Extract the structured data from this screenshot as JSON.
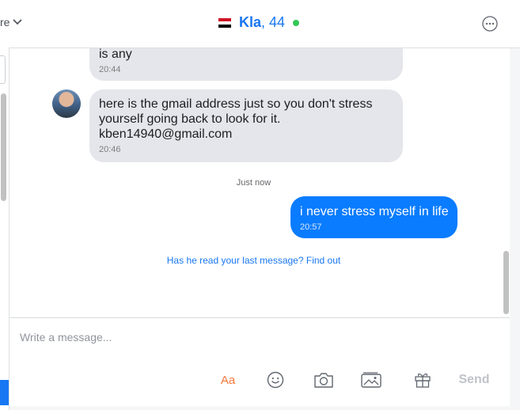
{
  "header": {
    "more_label": "re",
    "contact_name": "Kla",
    "contact_age": ", 44",
    "online": true,
    "colors": {
      "accent": "#1877f2",
      "online": "#31c754"
    }
  },
  "messages": [
    {
      "direction": "in",
      "text": "is any",
      "time": "20:44"
    },
    {
      "direction": "in",
      "text": "here is the gmail address just so you don't stress\nyourself going back to look for it.\nkben14940@gmail.com",
      "time": "20:46"
    },
    {
      "divider": "Just now"
    },
    {
      "direction": "out",
      "text": "i never stress myself in life",
      "time": "20:57"
    }
  ],
  "read_prompt": "Has he read your last message? Find out",
  "composer": {
    "placeholder": "Write a message...",
    "font_button": "Aa",
    "send_label": "Send",
    "icons": [
      "smiley-icon",
      "camera-icon",
      "photo-icon",
      "gift-icon"
    ]
  }
}
